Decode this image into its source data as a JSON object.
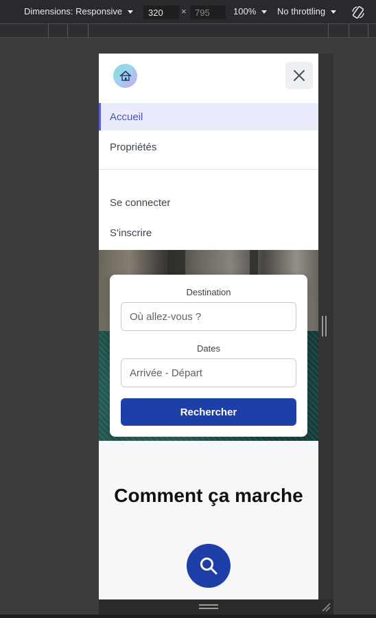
{
  "devtools": {
    "dimensions_label": "Dimensions: Responsive",
    "width_value": "320",
    "height_value": "795",
    "times": "×",
    "zoom": "100%",
    "throttling": "No throttling"
  },
  "nav": {
    "items": [
      {
        "label": "Accueil",
        "active": true
      },
      {
        "label": "Propriétés",
        "active": false
      },
      {
        "label": "Se connecter",
        "active": false
      },
      {
        "label": "S'inscrire",
        "active": false
      }
    ]
  },
  "search": {
    "destination_label": "Destination",
    "destination_placeholder": "Où allez-vous ?",
    "dates_label": "Dates",
    "dates_placeholder": "Arrivée - Départ",
    "button_label": "Rechercher"
  },
  "how_it_works": {
    "title": "Comment ça marche"
  },
  "colors": {
    "primary": "#1e3fa8",
    "active_nav_bg": "#eaecfb",
    "active_nav_text": "#4a4fc4"
  }
}
